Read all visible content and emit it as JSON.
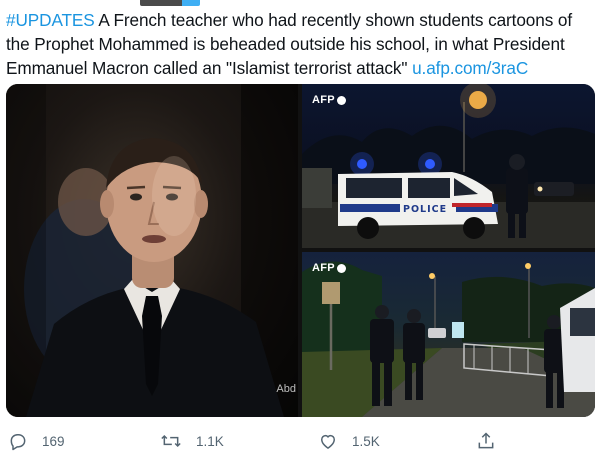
{
  "tweet": {
    "text_hashtag": "#UPDATES",
    "text_body": " A French teacher who had recently shown students cartoons of the Prophet Mohammed is beheaded outside his school, in what President Emmanuel Macron called an \"Islamist terrorist attack\" ",
    "text_link": "u.afp.com/3raC"
  },
  "media": {
    "watermark": "AFP",
    "photo_credit": "Abd"
  },
  "actions": {
    "reply_count": "169",
    "retweet_count": "1.1K",
    "like_count": "1.5K"
  },
  "icons": {
    "reply": "reply-icon",
    "retweet": "retweet-icon",
    "like": "heart-icon",
    "share": "share-icon",
    "afp_dot": "circle-icon"
  },
  "colors": {
    "text": "#0f1419",
    "link": "#1b95e0",
    "action_gray": "#536471",
    "police_blue": "#2f5bff"
  }
}
